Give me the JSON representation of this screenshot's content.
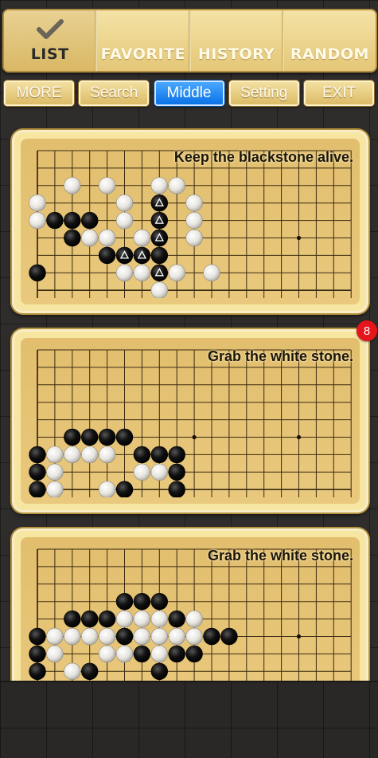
{
  "tabs": [
    {
      "id": "list",
      "label": "LIST",
      "active": true,
      "icon": "checkmark-icon"
    },
    {
      "id": "favorite",
      "label": "FAVORITE",
      "active": false
    },
    {
      "id": "history",
      "label": "HISTORY",
      "active": false
    },
    {
      "id": "random",
      "label": "RANDOM",
      "active": false
    }
  ],
  "toolbar": [
    {
      "id": "more",
      "label": "MORE",
      "active": false
    },
    {
      "id": "search",
      "label": "Search",
      "active": false
    },
    {
      "id": "middle",
      "label": "Middle",
      "active": true
    },
    {
      "id": "setting",
      "label": "Setting",
      "active": false
    },
    {
      "id": "exit",
      "label": "EXIT",
      "active": false
    }
  ],
  "colors": {
    "accent": "#1a7ff0",
    "badge": "#e6141b",
    "board": "#e2be6e",
    "frame": "#f7e5a2"
  },
  "problems": [
    {
      "title": "Keep the blackstone alive.",
      "badge": null,
      "star_points": [
        [
          15,
          5
        ]
      ],
      "black": [
        [
          1,
          4
        ],
        [
          2,
          4
        ],
        [
          3,
          4
        ],
        [
          2,
          5
        ],
        [
          4,
          6
        ],
        [
          5,
          6
        ],
        [
          6,
          6
        ],
        [
          7,
          3
        ],
        [
          7,
          4
        ],
        [
          7,
          5
        ],
        [
          7,
          6
        ],
        [
          7,
          7
        ],
        [
          0,
          7
        ]
      ],
      "white": [
        [
          2,
          2
        ],
        [
          4,
          2
        ],
        [
          7,
          2
        ],
        [
          8,
          2
        ],
        [
          0,
          3
        ],
        [
          5,
          3
        ],
        [
          9,
          3
        ],
        [
          0,
          4
        ],
        [
          5,
          4
        ],
        [
          9,
          4
        ],
        [
          3,
          5
        ],
        [
          4,
          5
        ],
        [
          6,
          5
        ],
        [
          9,
          5
        ],
        [
          5,
          6
        ],
        [
          5,
          7
        ],
        [
          6,
          7
        ],
        [
          8,
          7
        ],
        [
          10,
          7
        ],
        [
          7,
          8
        ]
      ],
      "marked": [
        [
          7,
          3
        ],
        [
          7,
          4
        ],
        [
          7,
          5
        ],
        [
          5,
          6
        ],
        [
          6,
          6
        ],
        [
          7,
          7
        ]
      ]
    },
    {
      "title": "Grab the white stone.",
      "badge": "8",
      "star_points": [
        [
          9,
          5
        ],
        [
          15,
          5
        ]
      ],
      "black": [
        [
          2,
          5
        ],
        [
          3,
          5
        ],
        [
          4,
          5
        ],
        [
          5,
          5
        ],
        [
          0,
          6
        ],
        [
          6,
          6
        ],
        [
          7,
          6
        ],
        [
          8,
          6
        ],
        [
          8,
          7
        ],
        [
          0,
          7
        ],
        [
          0,
          8
        ],
        [
          5,
          8
        ],
        [
          8,
          8
        ]
      ],
      "white": [
        [
          1,
          6
        ],
        [
          2,
          6
        ],
        [
          3,
          6
        ],
        [
          4,
          6
        ],
        [
          1,
          7
        ],
        [
          6,
          7
        ],
        [
          7,
          7
        ],
        [
          1,
          8
        ],
        [
          4,
          8
        ]
      ],
      "marked": []
    },
    {
      "title": "Grab the white stone.",
      "badge": null,
      "star_points": [
        [
          15,
          5
        ]
      ],
      "black": [
        [
          5,
          3
        ],
        [
          6,
          3
        ],
        [
          7,
          3
        ],
        [
          2,
          4
        ],
        [
          3,
          4
        ],
        [
          4,
          4
        ],
        [
          8,
          4
        ],
        [
          0,
          5
        ],
        [
          5,
          5
        ],
        [
          10,
          5
        ],
        [
          11,
          5
        ],
        [
          0,
          6
        ],
        [
          6,
          6
        ],
        [
          8,
          6
        ],
        [
          9,
          6
        ],
        [
          0,
          7
        ],
        [
          3,
          7
        ],
        [
          7,
          7
        ]
      ],
      "white": [
        [
          5,
          4
        ],
        [
          6,
          4
        ],
        [
          7,
          4
        ],
        [
          9,
          4
        ],
        [
          1,
          5
        ],
        [
          2,
          5
        ],
        [
          3,
          5
        ],
        [
          4,
          5
        ],
        [
          6,
          5
        ],
        [
          7,
          5
        ],
        [
          8,
          5
        ],
        [
          9,
          5
        ],
        [
          1,
          6
        ],
        [
          4,
          6
        ],
        [
          5,
          6
        ],
        [
          7,
          6
        ],
        [
          2,
          7
        ]
      ],
      "marked": []
    }
  ]
}
